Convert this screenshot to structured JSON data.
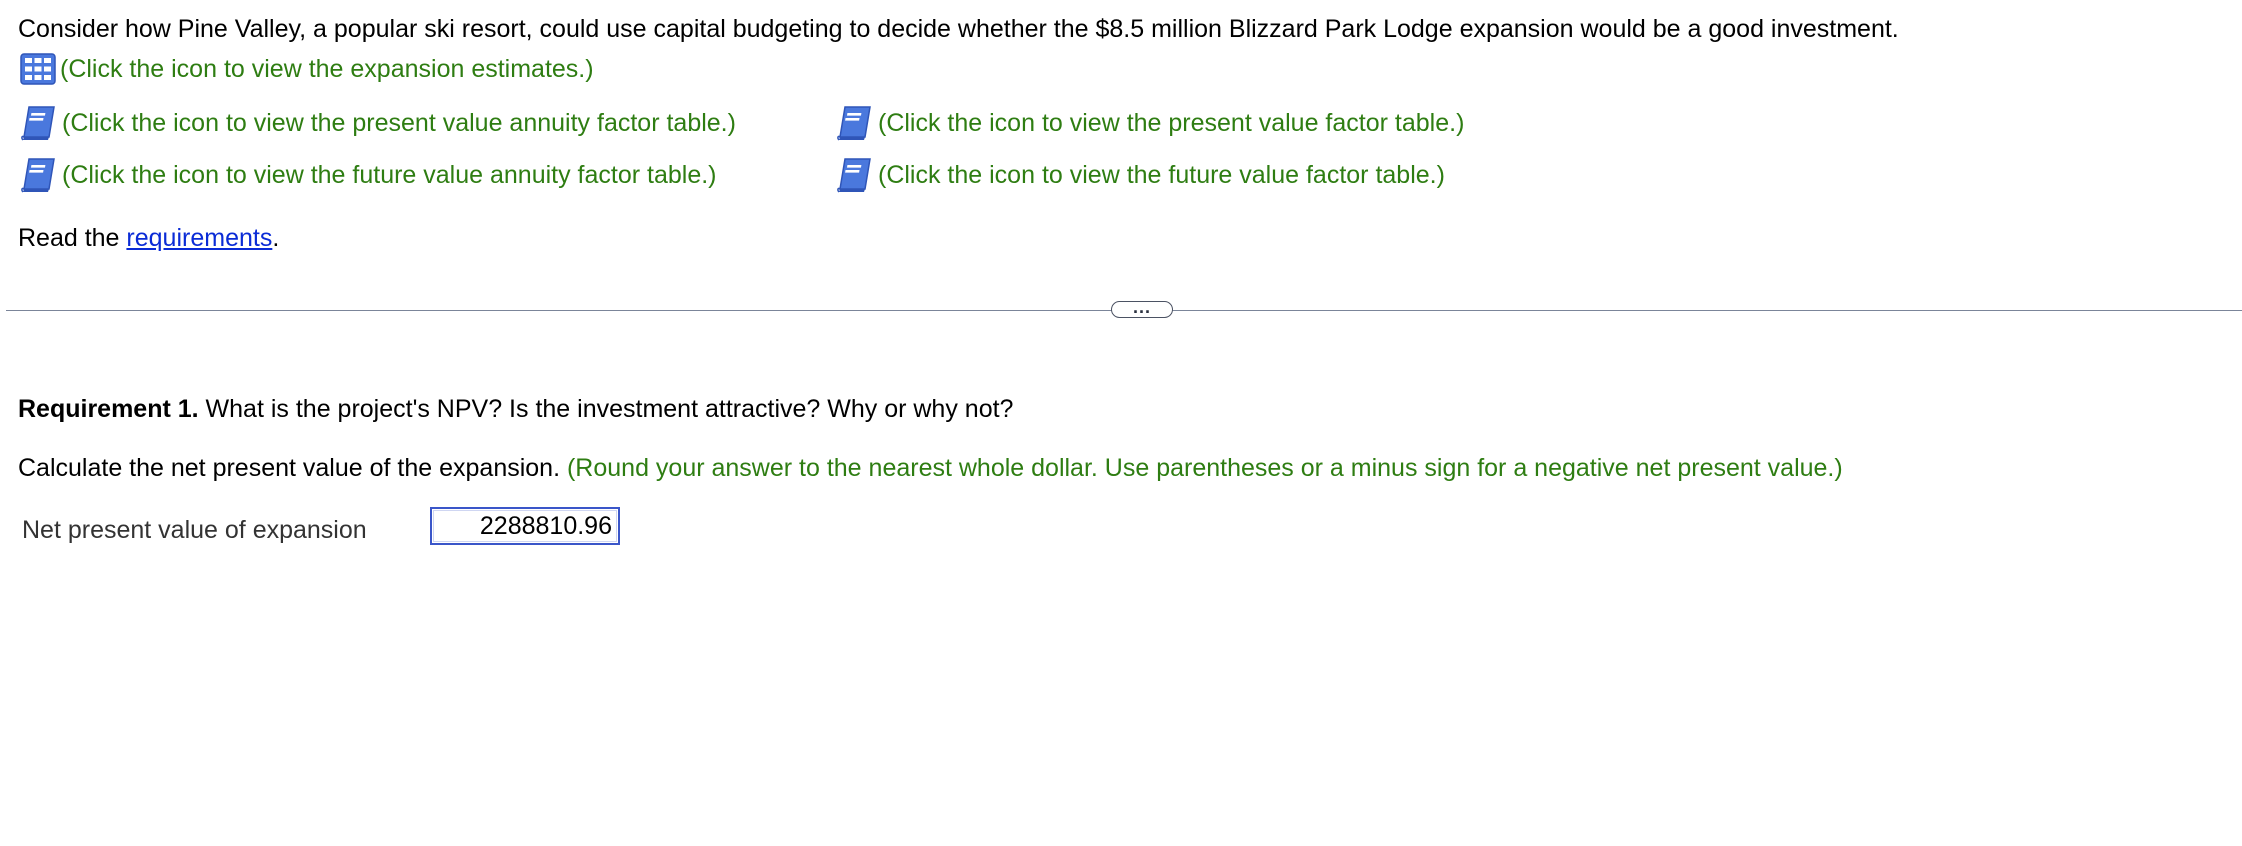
{
  "intro": {
    "text": "Consider how Pine Valley, a popular ski resort, could use capital budgeting to decide whether the $8.5 million Blizzard Park Lodge expansion would be a good investment."
  },
  "links": {
    "expansion_estimates": "(Click the icon to view the expansion estimates.)",
    "pv_annuity_table": "(Click the icon to view the present value annuity factor table.)",
    "pv_factor_table": "(Click the icon to view the present value factor table.)",
    "fv_annuity_table": "(Click the icon to view the future value annuity factor table.)",
    "fv_factor_table": "(Click the icon to view the future value factor table.)"
  },
  "icons": {
    "grid": "grid-table-icon",
    "book": "book-icon"
  },
  "read": {
    "prefix": "Read the ",
    "link": "requirements",
    "suffix": "."
  },
  "divider": {
    "button_label": "..."
  },
  "requirement1": {
    "label": "Requirement 1.",
    "question": " What is the project's NPV? Is the investment attractive? Why or why not?"
  },
  "calculate": {
    "text": "Calculate the net present value of the expansion. ",
    "hint": "(Round your answer to the nearest whole dollar. Use parentheses or a minus sign for a negative net present value.)"
  },
  "npv": {
    "label": "Net present value of expansion",
    "value": "2288810.96"
  },
  "colors": {
    "instruction_green": "#2e7d12",
    "link_blue": "#0a2bd6",
    "icon_blue": "#3f6fd9",
    "input_border": "#3a56c9"
  }
}
